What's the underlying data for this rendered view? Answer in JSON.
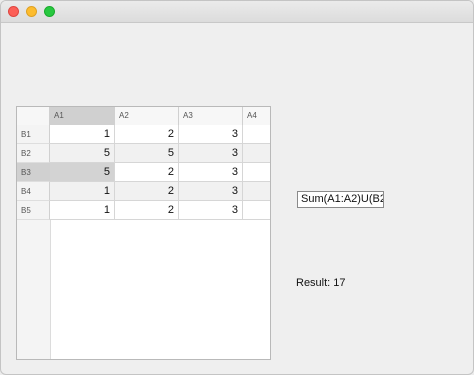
{
  "window": {
    "controls": [
      "close",
      "minimize",
      "maximize"
    ],
    "colors": {
      "close": "#fc5f57",
      "minimize": "#fdbc2e",
      "maximize": "#28c840"
    }
  },
  "table": {
    "columns": [
      "A1",
      "A2",
      "A3",
      "A4"
    ],
    "selected_column": "A1",
    "selected_row": "B3",
    "rows": [
      {
        "header": "B1",
        "cells": [
          "1",
          "2",
          "3",
          ""
        ]
      },
      {
        "header": "B2",
        "cells": [
          "5",
          "5",
          "3",
          ""
        ]
      },
      {
        "header": "B3",
        "cells": [
          "5",
          "2",
          "3",
          ""
        ]
      },
      {
        "header": "B4",
        "cells": [
          "1",
          "2",
          "3",
          ""
        ]
      },
      {
        "header": "B5",
        "cells": [
          "1",
          "2",
          "3",
          ""
        ]
      }
    ]
  },
  "formula": {
    "value": "Sum(A1:A2)U(B2"
  },
  "result": {
    "label": "Result: 17"
  }
}
